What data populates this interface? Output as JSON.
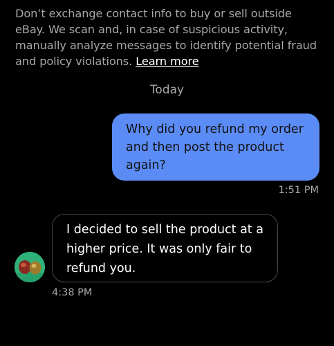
{
  "notice": {
    "text": "Don’t exchange contact info to buy or sell outside eBay. We scan and, in case of suspicious activity, manually analyze messages to identify potential fraud and policy violations.",
    "link_label": "Learn more"
  },
  "conversation": {
    "day_label": "Today",
    "messages": [
      {
        "direction": "outgoing",
        "text": "Why did you refund my order and then post the product again?",
        "time": "1:51 PM"
      },
      {
        "direction": "incoming",
        "text": "I decided to sell the product at a higher price. It was only fair to refund you.",
        "time": "4:38 PM"
      }
    ]
  },
  "colors": {
    "background": "#000000",
    "outgoing_bubble": "#5b8cf6",
    "secondary_text": "#a8a8a8",
    "incoming_border": "#4a4a4a"
  }
}
